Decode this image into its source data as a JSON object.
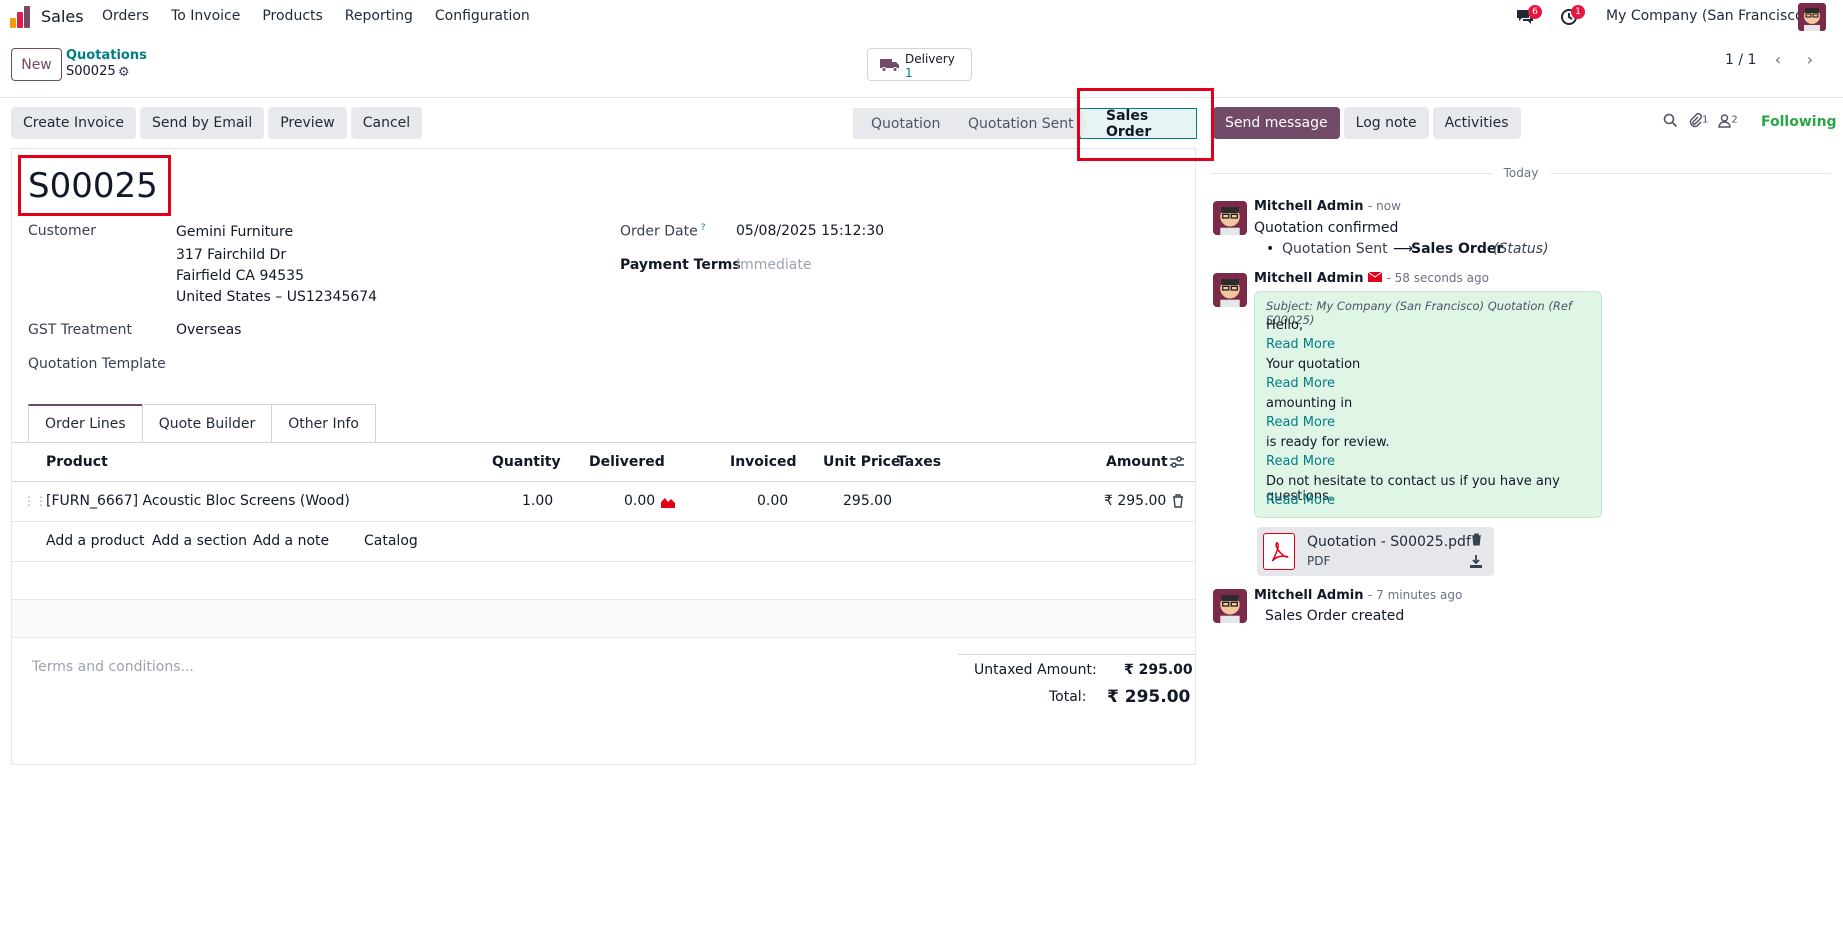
{
  "topnav": {
    "app": "Sales",
    "menu": [
      "Orders",
      "To Invoice",
      "Products",
      "Reporting",
      "Configuration"
    ],
    "chat_badge": "6",
    "activity_badge": "1",
    "company": "My Company (San Francisco)"
  },
  "control": {
    "new_label": "New",
    "breadcrumb_parent": "Quotations",
    "breadcrumb_current": "S00025",
    "delivery_label": "Delivery",
    "delivery_count": "1",
    "pager": "1 / 1"
  },
  "actions": [
    "Create Invoice",
    "Send by Email",
    "Preview",
    "Cancel"
  ],
  "status": {
    "steps": [
      "Quotation",
      "Quotation Sent",
      "Sales Order"
    ],
    "current": "Sales Order"
  },
  "chatter_toolbar": {
    "send": "Send message",
    "log": "Log note",
    "activities": "Activities",
    "attachments_count": "1",
    "followers_count": "2",
    "following": "Following"
  },
  "form": {
    "name": "S00025",
    "customer_label": "Customer",
    "customer_name": "Gemini Furniture",
    "address1": "317 Fairchild Dr",
    "address2": "Fairfield CA 94535",
    "address3": "United States – US12345674",
    "gst_label": "GST Treatment",
    "gst_value": "Overseas",
    "template_label": "Quotation Template",
    "order_date_label": "Order Date",
    "order_date_help": "?",
    "order_date": "05/08/2025 15:12:30",
    "payment_terms_label": "Payment Terms",
    "payment_terms": "Immediate"
  },
  "tabs": [
    "Order Lines",
    "Quote Builder",
    "Other Info"
  ],
  "lines": {
    "headers": {
      "product": "Product",
      "quantity": "Quantity",
      "delivered": "Delivered",
      "invoiced": "Invoiced",
      "unit_price": "Unit Price",
      "taxes": "Taxes",
      "amount": "Amount"
    },
    "rows": [
      {
        "product": "[FURN_6667] Acoustic Bloc Screens (Wood)",
        "quantity": "1.00",
        "delivered": "0.00",
        "invoiced": "0.00",
        "unit_price": "295.00",
        "taxes": "",
        "amount": "₹ 295.00"
      }
    ],
    "add_product": "Add a product",
    "add_section": "Add a section",
    "add_note": "Add a note",
    "catalog": "Catalog"
  },
  "terms_placeholder": "Terms and conditions...",
  "totals": {
    "untaxed_label": "Untaxed Amount:",
    "untaxed_value": "₹ 295.00",
    "total_label": "Total:",
    "total_value": "₹ 295.00"
  },
  "chatter": {
    "day": "Today",
    "messages": [
      {
        "author": "Mitchell Admin",
        "when": "- now",
        "text": "Quotation confirmed",
        "change_from": "Quotation Sent",
        "change_to": "Sales Order",
        "change_field": "(Status)"
      },
      {
        "author": "Mitchell Admin",
        "when": "- 58 seconds ago",
        "subject": "Subject: My Company (San Francisco) Quotation (Ref S00025)",
        "lines": [
          "Hello,",
          "Read More",
          "Your quotation",
          "Read More",
          "amounting in",
          "Read More",
          "is ready for review.",
          "Read More",
          "Do not hesitate to contact us if you have any questions.",
          "Read More"
        ],
        "attachment_name": "Quotation - S00025.pdf",
        "attachment_type": "PDF"
      },
      {
        "author": "Mitchell Admin",
        "when": "- 7 minutes ago",
        "text": "Sales Order created"
      }
    ]
  },
  "colors": {
    "brand": "#714b67",
    "link": "#017e84",
    "highlight": "#e0001a",
    "following": "#28a745"
  }
}
